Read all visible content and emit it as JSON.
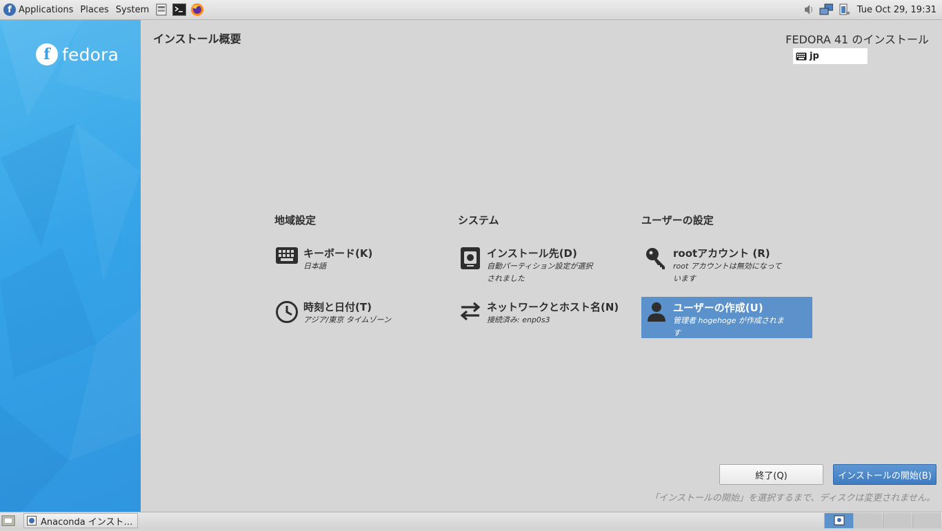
{
  "topbar": {
    "menus": [
      "Applications",
      "Places",
      "System"
    ],
    "clock": "Tue Oct 29, 19:31"
  },
  "sidebar": {
    "logo_text": "fedora"
  },
  "header": {
    "title": "インストール概要",
    "product": "FEDORA 41 のインストール",
    "keyboard_layout": "jp"
  },
  "columns": [
    {
      "heading": "地域設定",
      "spokes": [
        {
          "icon": "keyboard-icon",
          "title": "キーボード(K)",
          "status": "日本語"
        },
        {
          "icon": "clock-icon",
          "title": "時刻と日付(T)",
          "status": "アジア/東京 タイムゾーン"
        }
      ]
    },
    {
      "heading": "システム",
      "spokes": [
        {
          "icon": "disk-icon",
          "title": "インストール先(D)",
          "status_line1": "自動パーティション設定が選択",
          "status_line2": "されました"
        },
        {
          "icon": "network-icon",
          "title": "ネットワークとホスト名(N)",
          "status": "接続済み: enp0s3"
        }
      ]
    },
    {
      "heading": "ユーザーの設定",
      "spokes": [
        {
          "icon": "key-icon",
          "title": "rootアカウント (R)",
          "status_line1": "root アカウントは無効になって",
          "status_line2": "います"
        },
        {
          "icon": "user-icon",
          "title": "ユーザーの作成(U)",
          "status_line1": "管理者 hogehoge が作成されま",
          "status_line2": "す",
          "selected": true
        }
      ]
    }
  ],
  "buttons": {
    "quit": "終了(Q)",
    "begin": "インストールの開始(B)"
  },
  "warning": "「インストールの開始」を選択するまで、ディスクは変更されません。",
  "taskbar": {
    "window_label": "Anaconda インスト…"
  },
  "colors": {
    "selected": "#5b92cc",
    "sidebar": "#35a4e8",
    "begin_button": "#4a86c8"
  }
}
